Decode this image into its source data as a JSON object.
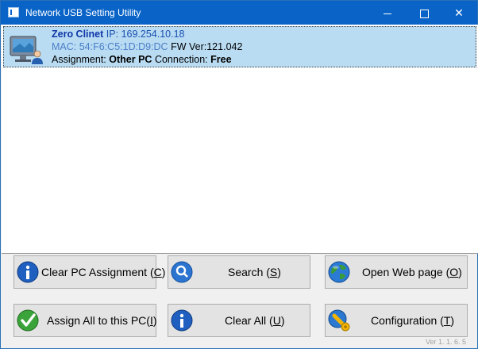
{
  "window": {
    "title": "Network USB Setting Utility"
  },
  "device": {
    "name": "Zero Clinet",
    "ip_label": "IP:",
    "ip": "169.254.10.18",
    "mac_label": "MAC:",
    "mac": "54:F6:C5:1D:D9:DC",
    "fw_label": "FW Ver:",
    "fw": "121.042",
    "assignment_label": "Assignment:",
    "assignment": "Other PC",
    "connection_label": "Connection:",
    "connection": "Free"
  },
  "buttons": {
    "clear_pc_assignment": {
      "label": "Clear PC Assignment (",
      "key": "C",
      "end": ")"
    },
    "search": {
      "label": "Search (",
      "key": "S",
      "end": ")"
    },
    "open_web_page": {
      "label": "Open Web page (",
      "key": "O",
      "end": ")"
    },
    "assign_all": {
      "label": "Assign All  to this PC(",
      "key": "I",
      "end": ")"
    },
    "clear_all": {
      "label": "Clear All (",
      "key": "U",
      "end": ")"
    },
    "configuration": {
      "label": "Configuration (",
      "key": "T",
      "end": ")"
    }
  },
  "version": "Ver 1. 1. 6. 5",
  "icons": {
    "app": "app-window-icon",
    "device": "computer-user-icon",
    "info": "info-icon",
    "search": "magnifier-icon",
    "globe": "globe-icon",
    "check": "checkmark-icon",
    "config": "wrench-icon"
  }
}
